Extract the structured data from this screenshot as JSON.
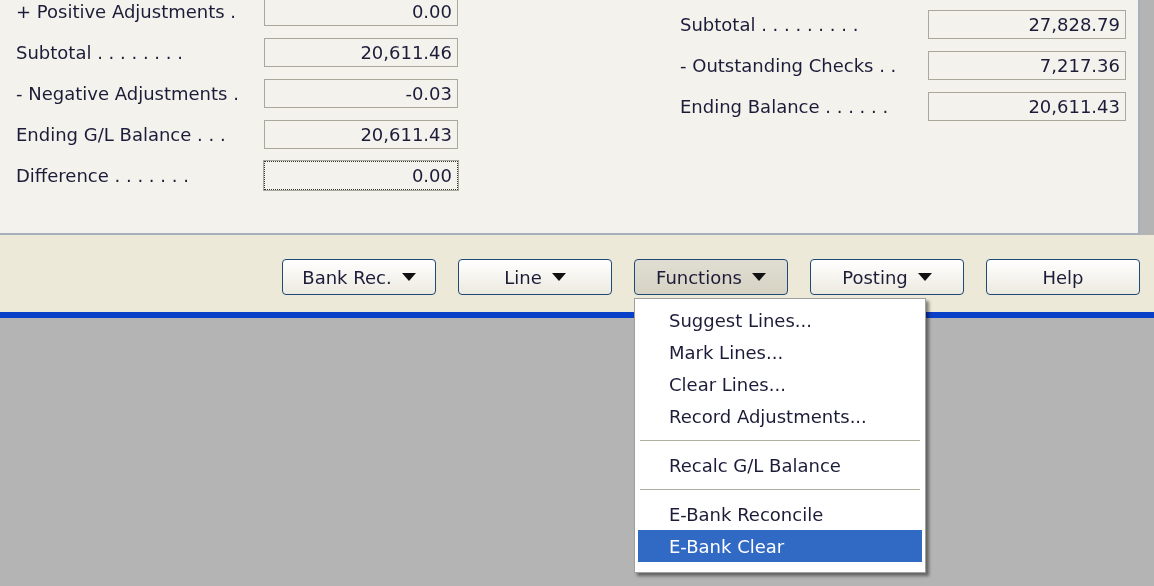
{
  "left_fields": [
    {
      "label": "+ Positive Adjustments .",
      "value": "0.00",
      "focused": false
    },
    {
      "label": "Subtotal . . . . . . . .",
      "value": "20,611.46",
      "focused": false
    },
    {
      "label": "- Negative Adjustments .",
      "value": "-0.03",
      "focused": false
    },
    {
      "label": "Ending G/L Balance . . .",
      "value": "20,611.43",
      "focused": false
    },
    {
      "label": "Difference . . . . . . .",
      "value": "0.00",
      "focused": true
    }
  ],
  "right_fields": [
    {
      "label": "Subtotal . . . . . . . . .",
      "value": "27,828.79",
      "focused": false
    },
    {
      "label": "- Outstanding Checks . .",
      "value": "7,217.36",
      "focused": false
    },
    {
      "label": "Ending Balance . . . . . .",
      "value": "20,611.43",
      "focused": false
    }
  ],
  "buttons": [
    {
      "label": "Bank Rec.",
      "kind": "menu",
      "pressed": false
    },
    {
      "label": "Line",
      "kind": "menu",
      "pressed": false
    },
    {
      "label": "Functions",
      "kind": "menu",
      "pressed": true
    },
    {
      "label": "Posting",
      "kind": "menu",
      "pressed": false
    },
    {
      "label": "Help",
      "kind": "plain",
      "pressed": false
    }
  ],
  "menu": {
    "items": [
      {
        "kind": "item",
        "label": "Suggest Lines...",
        "selected": false
      },
      {
        "kind": "item",
        "label": "Mark Lines...",
        "selected": false
      },
      {
        "kind": "item",
        "label": "Clear Lines...",
        "selected": false
      },
      {
        "kind": "item",
        "label": "Record Adjustments...",
        "selected": false
      },
      {
        "kind": "separator"
      },
      {
        "kind": "item",
        "label": "Recalc G/L Balance",
        "selected": false
      },
      {
        "kind": "separator"
      },
      {
        "kind": "item",
        "label": "E-Bank Reconcile",
        "selected": false
      },
      {
        "kind": "item",
        "label": "E-Bank Clear",
        "selected": true
      }
    ]
  }
}
